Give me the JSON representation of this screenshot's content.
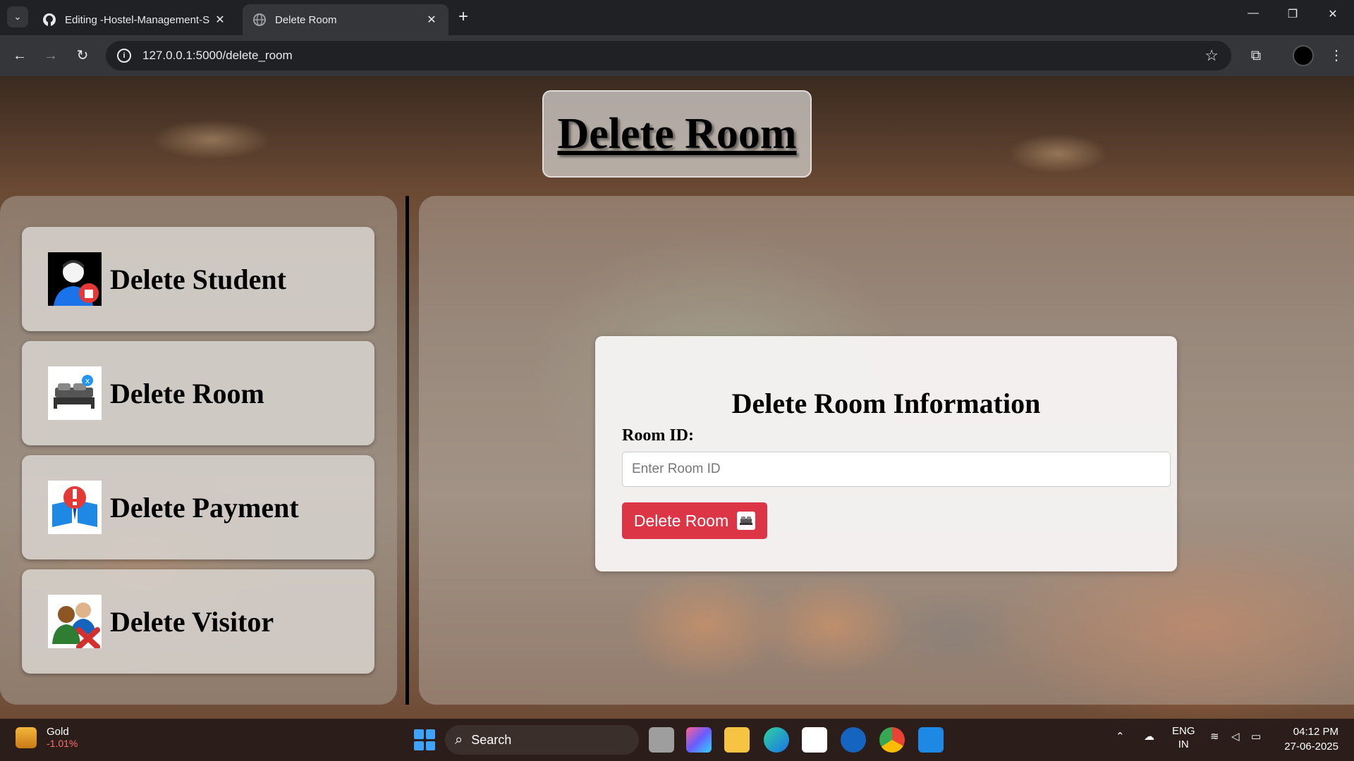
{
  "browser": {
    "tabs": [
      {
        "title": "Editing -Hostel-Management-S",
        "icon": "github-icon",
        "active": false
      },
      {
        "title": "Delete Room",
        "icon": "globe-icon",
        "active": true
      }
    ],
    "url": "127.0.0.1:5000/delete_room"
  },
  "page": {
    "title": "Delete Room",
    "sidebar": {
      "items": [
        {
          "label": "Delete Student",
          "icon": "student-delete-icon"
        },
        {
          "label": "Delete Room",
          "icon": "bed-delete-icon"
        },
        {
          "label": "Delete Payment",
          "icon": "payment-alert-icon"
        },
        {
          "label": "Delete Visitor",
          "icon": "visitor-delete-icon"
        }
      ]
    },
    "form": {
      "heading": "Delete Room Information",
      "room_id_label": "Room ID:",
      "room_id_placeholder": "Enter Room ID",
      "room_id_value": "",
      "submit_label": "Delete Room"
    }
  },
  "taskbar": {
    "widget": {
      "name": "Gold",
      "change": "-1.01%"
    },
    "search_placeholder": "Search",
    "language": "ENG",
    "region": "IN",
    "time": "04:12 PM",
    "date": "27-06-2025"
  },
  "colors": {
    "accent_button": "#dc3545",
    "page_bg": "#6b4a34"
  }
}
